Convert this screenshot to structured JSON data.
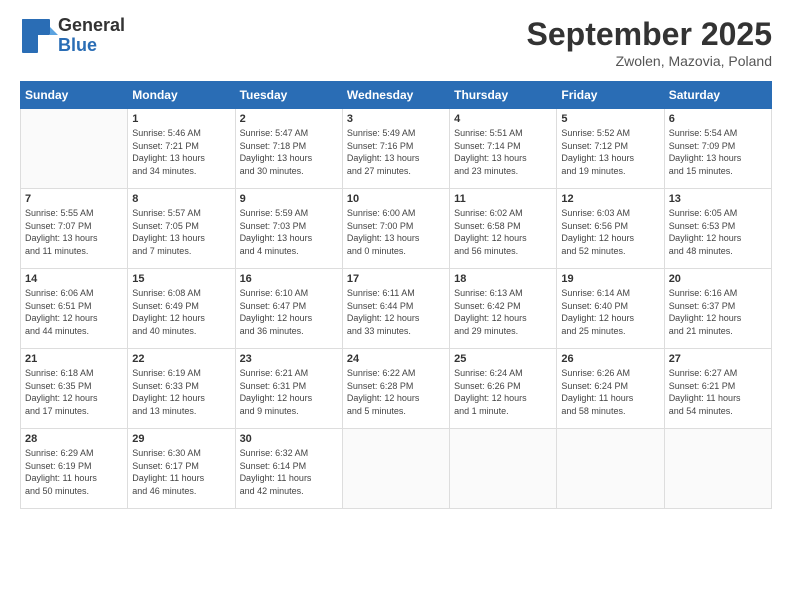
{
  "header": {
    "logo_general": "General",
    "logo_blue": "Blue",
    "month_title": "September 2025",
    "location": "Zwolen, Mazovia, Poland"
  },
  "weekdays": [
    "Sunday",
    "Monday",
    "Tuesday",
    "Wednesday",
    "Thursday",
    "Friday",
    "Saturday"
  ],
  "weeks": [
    [
      {
        "day": "",
        "info": ""
      },
      {
        "day": "1",
        "info": "Sunrise: 5:46 AM\nSunset: 7:21 PM\nDaylight: 13 hours\nand 34 minutes."
      },
      {
        "day": "2",
        "info": "Sunrise: 5:47 AM\nSunset: 7:18 PM\nDaylight: 13 hours\nand 30 minutes."
      },
      {
        "day": "3",
        "info": "Sunrise: 5:49 AM\nSunset: 7:16 PM\nDaylight: 13 hours\nand 27 minutes."
      },
      {
        "day": "4",
        "info": "Sunrise: 5:51 AM\nSunset: 7:14 PM\nDaylight: 13 hours\nand 23 minutes."
      },
      {
        "day": "5",
        "info": "Sunrise: 5:52 AM\nSunset: 7:12 PM\nDaylight: 13 hours\nand 19 minutes."
      },
      {
        "day": "6",
        "info": "Sunrise: 5:54 AM\nSunset: 7:09 PM\nDaylight: 13 hours\nand 15 minutes."
      }
    ],
    [
      {
        "day": "7",
        "info": "Sunrise: 5:55 AM\nSunset: 7:07 PM\nDaylight: 13 hours\nand 11 minutes."
      },
      {
        "day": "8",
        "info": "Sunrise: 5:57 AM\nSunset: 7:05 PM\nDaylight: 13 hours\nand 7 minutes."
      },
      {
        "day": "9",
        "info": "Sunrise: 5:59 AM\nSunset: 7:03 PM\nDaylight: 13 hours\nand 4 minutes."
      },
      {
        "day": "10",
        "info": "Sunrise: 6:00 AM\nSunset: 7:00 PM\nDaylight: 13 hours\nand 0 minutes."
      },
      {
        "day": "11",
        "info": "Sunrise: 6:02 AM\nSunset: 6:58 PM\nDaylight: 12 hours\nand 56 minutes."
      },
      {
        "day": "12",
        "info": "Sunrise: 6:03 AM\nSunset: 6:56 PM\nDaylight: 12 hours\nand 52 minutes."
      },
      {
        "day": "13",
        "info": "Sunrise: 6:05 AM\nSunset: 6:53 PM\nDaylight: 12 hours\nand 48 minutes."
      }
    ],
    [
      {
        "day": "14",
        "info": "Sunrise: 6:06 AM\nSunset: 6:51 PM\nDaylight: 12 hours\nand 44 minutes."
      },
      {
        "day": "15",
        "info": "Sunrise: 6:08 AM\nSunset: 6:49 PM\nDaylight: 12 hours\nand 40 minutes."
      },
      {
        "day": "16",
        "info": "Sunrise: 6:10 AM\nSunset: 6:47 PM\nDaylight: 12 hours\nand 36 minutes."
      },
      {
        "day": "17",
        "info": "Sunrise: 6:11 AM\nSunset: 6:44 PM\nDaylight: 12 hours\nand 33 minutes."
      },
      {
        "day": "18",
        "info": "Sunrise: 6:13 AM\nSunset: 6:42 PM\nDaylight: 12 hours\nand 29 minutes."
      },
      {
        "day": "19",
        "info": "Sunrise: 6:14 AM\nSunset: 6:40 PM\nDaylight: 12 hours\nand 25 minutes."
      },
      {
        "day": "20",
        "info": "Sunrise: 6:16 AM\nSunset: 6:37 PM\nDaylight: 12 hours\nand 21 minutes."
      }
    ],
    [
      {
        "day": "21",
        "info": "Sunrise: 6:18 AM\nSunset: 6:35 PM\nDaylight: 12 hours\nand 17 minutes."
      },
      {
        "day": "22",
        "info": "Sunrise: 6:19 AM\nSunset: 6:33 PM\nDaylight: 12 hours\nand 13 minutes."
      },
      {
        "day": "23",
        "info": "Sunrise: 6:21 AM\nSunset: 6:31 PM\nDaylight: 12 hours\nand 9 minutes."
      },
      {
        "day": "24",
        "info": "Sunrise: 6:22 AM\nSunset: 6:28 PM\nDaylight: 12 hours\nand 5 minutes."
      },
      {
        "day": "25",
        "info": "Sunrise: 6:24 AM\nSunset: 6:26 PM\nDaylight: 12 hours\nand 1 minute."
      },
      {
        "day": "26",
        "info": "Sunrise: 6:26 AM\nSunset: 6:24 PM\nDaylight: 11 hours\nand 58 minutes."
      },
      {
        "day": "27",
        "info": "Sunrise: 6:27 AM\nSunset: 6:21 PM\nDaylight: 11 hours\nand 54 minutes."
      }
    ],
    [
      {
        "day": "28",
        "info": "Sunrise: 6:29 AM\nSunset: 6:19 PM\nDaylight: 11 hours\nand 50 minutes."
      },
      {
        "day": "29",
        "info": "Sunrise: 6:30 AM\nSunset: 6:17 PM\nDaylight: 11 hours\nand 46 minutes."
      },
      {
        "day": "30",
        "info": "Sunrise: 6:32 AM\nSunset: 6:14 PM\nDaylight: 11 hours\nand 42 minutes."
      },
      {
        "day": "",
        "info": ""
      },
      {
        "day": "",
        "info": ""
      },
      {
        "day": "",
        "info": ""
      },
      {
        "day": "",
        "info": ""
      }
    ]
  ]
}
